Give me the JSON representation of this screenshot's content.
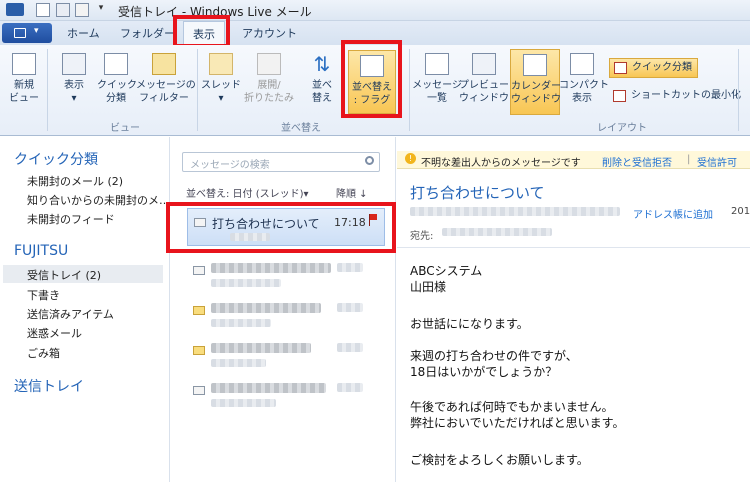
{
  "window": {
    "title": "受信トレイ - Windows Live メール"
  },
  "tabs": [
    {
      "label": "ホーム"
    },
    {
      "label": "フォルダー"
    },
    {
      "label": "表示"
    },
    {
      "label": "アカウント"
    }
  ],
  "ribbon": {
    "view": {
      "new_view": "新規\nビュー",
      "display": "表示",
      "quick_views": "クイック\n分類",
      "message_filter": "メッセージの\nフィルター",
      "group_label": "ビュー"
    },
    "sort": {
      "thread": "スレッド",
      "expand": "展開/\n折りたたみ",
      "sort": "並べ\n替え",
      "sort_flag": "並べ替え\n: フラグ",
      "group_label": "並べ替え"
    },
    "layout": {
      "message_list": "メッセージ\n一覧",
      "preview_window": "プレビュー\nウィンドウ",
      "calendar_window": "カレンダー\nウィンドウ",
      "compact_view": "コンパクト\n表示",
      "quick_views_btn": "クイック分類",
      "minimize_shortcuts": "ショートカットの最小化",
      "group_label": "レイアウト"
    }
  },
  "folders": {
    "quick_views_header": "クイック分類",
    "quick_items": [
      "未開封のメール (2)",
      "知り合いからの未開封のメ…",
      "未開封のフィード"
    ],
    "account_header": "FUJITSU",
    "account_items": [
      "受信トレイ (2)",
      "下書き",
      "送信済みアイテム",
      "迷惑メール",
      "ごみ箱"
    ],
    "outbox": "送信トレイ"
  },
  "message_list": {
    "search_placeholder": "メッセージの検索",
    "sort_label": "並べ替え: 日付 (スレッド)▾",
    "order_label": "降順 ↓",
    "selected": {
      "subject": "打ち合わせについて",
      "time": "17:18"
    }
  },
  "reading": {
    "warning": "不明な差出人からのメッセージです",
    "delete_block": "削除と受信拒否",
    "allow": "受信許可",
    "subject": "打ち合わせについて",
    "add_contact": "アドレス帳に追加",
    "year_partial": "201",
    "to_label": "宛先:",
    "body": [
      "ABCシステム",
      "山田様",
      "",
      "お世話にになります。",
      "",
      "来週の打ち合わせの件ですが、",
      "18日はいかがでしょうか？",
      "",
      "午後であれば何時でもかまいません。",
      "弊社においでいただければと思います。",
      "",
      "ご検討をよろしくお願いします。"
    ]
  },
  "colors": {
    "accent": "#2464b7",
    "highlight_box": "#e8141c"
  }
}
